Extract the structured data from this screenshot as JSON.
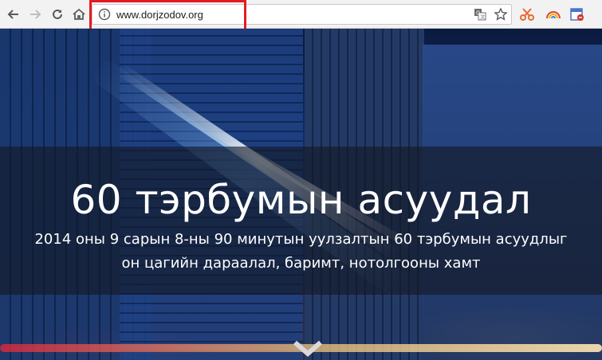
{
  "browser": {
    "url": "www.dorjzodov.org",
    "icons": [
      "back-icon",
      "forward-icon",
      "reload-icon",
      "home-icon",
      "info-icon",
      "translate-icon",
      "star-icon",
      "scissors-extension-icon",
      "rainbow-extension-icon",
      "calendar-extension-icon"
    ],
    "highlight_color": "#e31b23"
  },
  "hero": {
    "title": "60 тэрбумын асуудал",
    "subtitle": "2014 оны 9 сарын 8-ны 90 минутын уулзалтын 60 тэрбумын асуудлыг он цагийн дараалал, баримт, нотолгооны хамт",
    "scroll_icon": "chevron-down-icon"
  }
}
